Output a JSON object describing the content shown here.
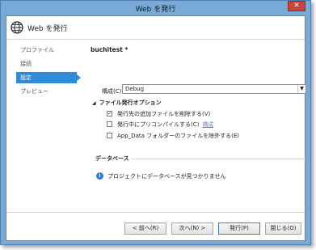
{
  "window": {
    "title": "Web を発行",
    "close_glyph": "✕"
  },
  "header": {
    "title": "Web を発行",
    "icon": "globe-icon"
  },
  "sidebar": {
    "items": [
      {
        "label": "プロファイル"
      },
      {
        "label": "接続"
      },
      {
        "label": "設定"
      },
      {
        "label": "プレビュー"
      }
    ],
    "active_index": 2
  },
  "main": {
    "profile_name": "buchitest *",
    "configuration": {
      "label": "構成(C):",
      "value": "Debug"
    },
    "file_options": {
      "title": "ファイル発行オプション",
      "items": [
        {
          "label": "発行先の追加ファイルを削除する(V)",
          "checked": true
        },
        {
          "label": "発行中にプリコンパイルする(C)",
          "checked": false,
          "link": "構成"
        },
        {
          "label": "App_Data フォルダーのファイルを除外する(E)",
          "checked": false
        }
      ]
    },
    "database": {
      "title": "データベース",
      "message": "プロジェクトにデータベースが見つかりません"
    }
  },
  "footer": {
    "prev": "< 前へ(R)",
    "next": "次へ(N) >",
    "publish": "発行(P)",
    "close": "閉じる(O)"
  },
  "colors": {
    "accent": "#2f8ad8",
    "titlebar": "#79a9d5",
    "close": "#c7463f"
  }
}
